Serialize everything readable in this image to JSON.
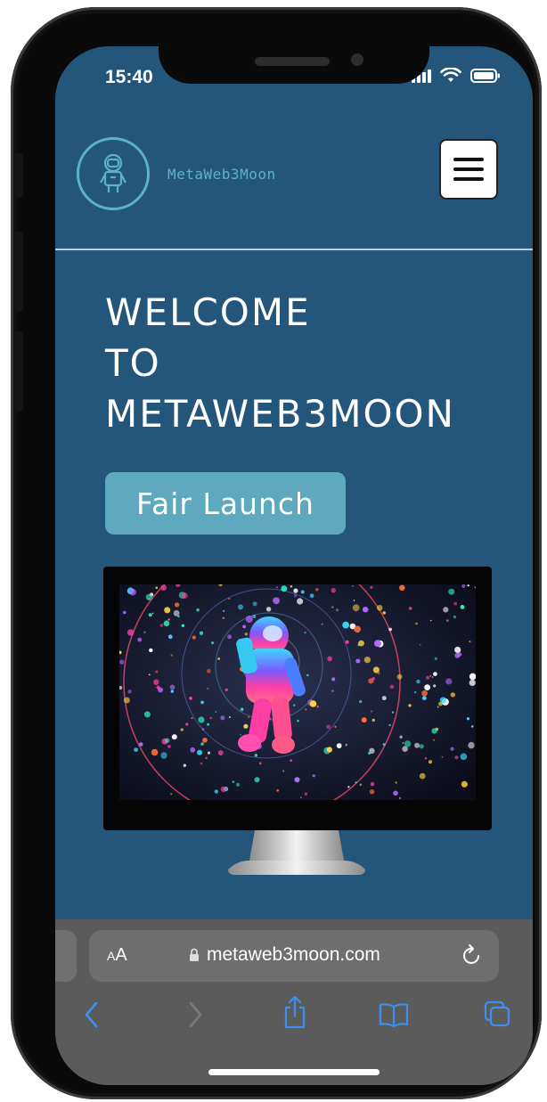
{
  "status_bar": {
    "time": "15:40"
  },
  "header": {
    "brand": "MetaWeb3Moon",
    "logo_icon": "astronaut-icon",
    "menu_icon": "hamburger-menu-icon"
  },
  "hero": {
    "title_lines": [
      "WELCOME",
      "TO",
      "METAWEB3MOON"
    ],
    "cta_label": "Fair Launch",
    "image_icon": "astronaut-space-artwork"
  },
  "browser": {
    "text_size_label": "AA",
    "url": "metaweb3moon.com",
    "toolbar_icons": [
      "back-icon",
      "forward-icon",
      "share-icon",
      "bookmarks-icon",
      "tabs-icon"
    ]
  },
  "colors": {
    "background": "#24557b",
    "accent": "#5db3c6",
    "button": "#5ea9bd",
    "browser_bar": "#5b5b5b",
    "toolbar_icon": "#3d8ff2"
  }
}
